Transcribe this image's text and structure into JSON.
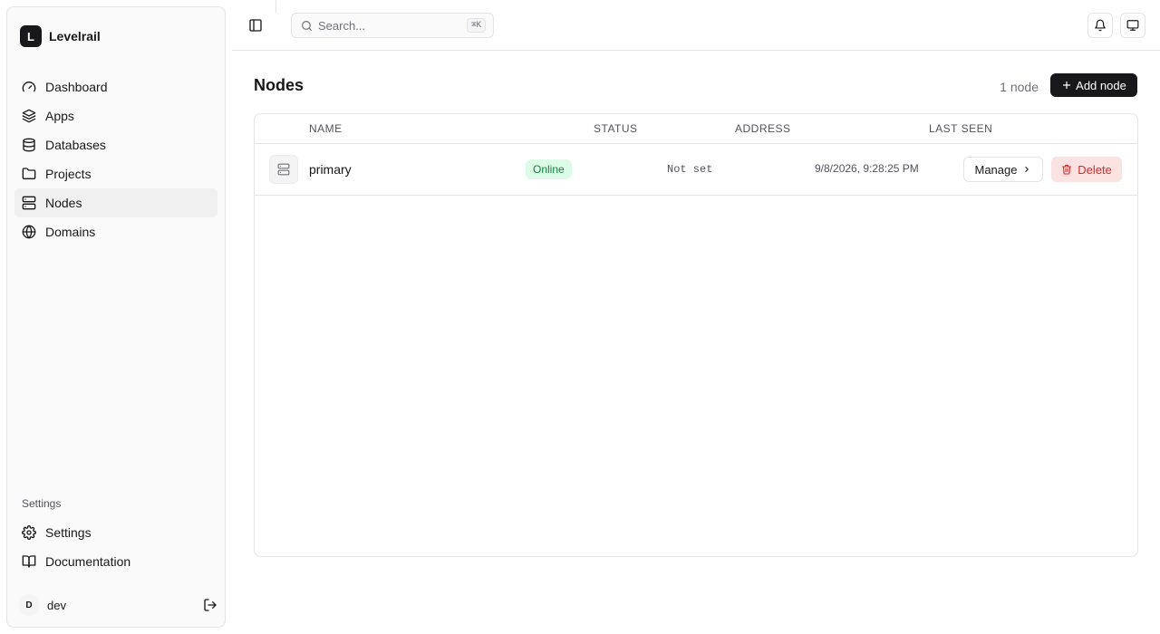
{
  "brand": {
    "logo_letter": "L",
    "name": "Levelrail"
  },
  "sidebar": {
    "items": [
      {
        "label": "Dashboard",
        "icon": "gauge-icon"
      },
      {
        "label": "Apps",
        "icon": "layers-icon"
      },
      {
        "label": "Databases",
        "icon": "database-icon"
      },
      {
        "label": "Projects",
        "icon": "folder-icon"
      },
      {
        "label": "Nodes",
        "icon": "server-icon",
        "active": true
      },
      {
        "label": "Domains",
        "icon": "globe-icon"
      }
    ],
    "settings_section_label": "Settings",
    "bottom_items": [
      {
        "label": "Settings",
        "icon": "gear-icon"
      },
      {
        "label": "Documentation",
        "icon": "book-icon"
      }
    ],
    "user": {
      "initial": "D",
      "name": "dev"
    }
  },
  "topbar": {
    "search_placeholder": "Search...",
    "search_shortcut": "⌘K"
  },
  "page": {
    "title": "Nodes",
    "count_label": "1 node",
    "add_button_label": "Add node"
  },
  "table": {
    "columns": [
      "NAME",
      "STATUS",
      "ADDRESS",
      "LAST SEEN"
    ],
    "rows": [
      {
        "name": "primary",
        "status": "Online",
        "address": "Not set",
        "last_seen": "9/8/2026, 9:28:25 PM",
        "manage_label": "Manage",
        "delete_label": "Delete"
      }
    ]
  },
  "colors": {
    "accent": "#18181b",
    "status_online_bg": "#dcfce7",
    "status_online_text": "#15803d",
    "danger_bg": "#fde2e2",
    "danger_text": "#dc2626"
  }
}
